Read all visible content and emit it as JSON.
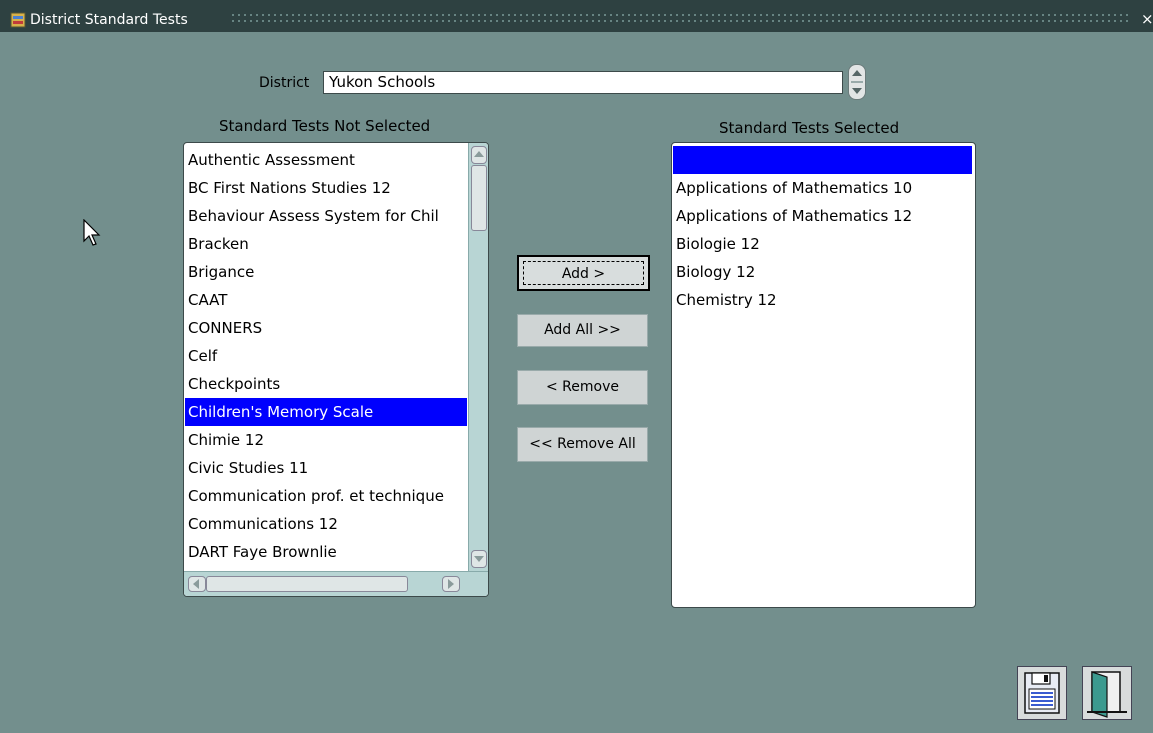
{
  "window": {
    "title": "District Standard Tests",
    "close_glyph": "×"
  },
  "district": {
    "label": "District",
    "value": "Yukon Schools"
  },
  "left": {
    "header": "Standard Tests Not Selected",
    "items": [
      "Authentic Assessment",
      "BC First Nations Studies 12",
      "Behaviour Assess System for Chil",
      "Bracken",
      "Brigance",
      "CAAT",
      "CONNERS",
      "Celf",
      "Checkpoints",
      "Children's Memory Scale",
      "Chimie 12",
      "Civic Studies 11",
      "Communication prof. et technique",
      "Communications 12",
      "DART Faye Brownlie"
    ],
    "selected_index": 9
  },
  "right": {
    "header": "Standard Tests Selected",
    "items": [
      "",
      "Applications of Mathematics 10",
      "Applications of Mathematics 12",
      "Biologie 12",
      "Biology 12",
      "Chemistry 12"
    ],
    "selected_index": 0
  },
  "buttons": {
    "add": "Add >",
    "add_all": "Add All >>",
    "remove": "< Remove",
    "remove_all": "<< Remove All"
  },
  "icons": {
    "save": "save-icon",
    "exit": "exit-door-icon"
  },
  "colors": {
    "window_bg": "#738f8d",
    "titlebar_bg": "#2e4141",
    "selection": "#0000fe",
    "scrollbar": "#b8d5d4"
  }
}
